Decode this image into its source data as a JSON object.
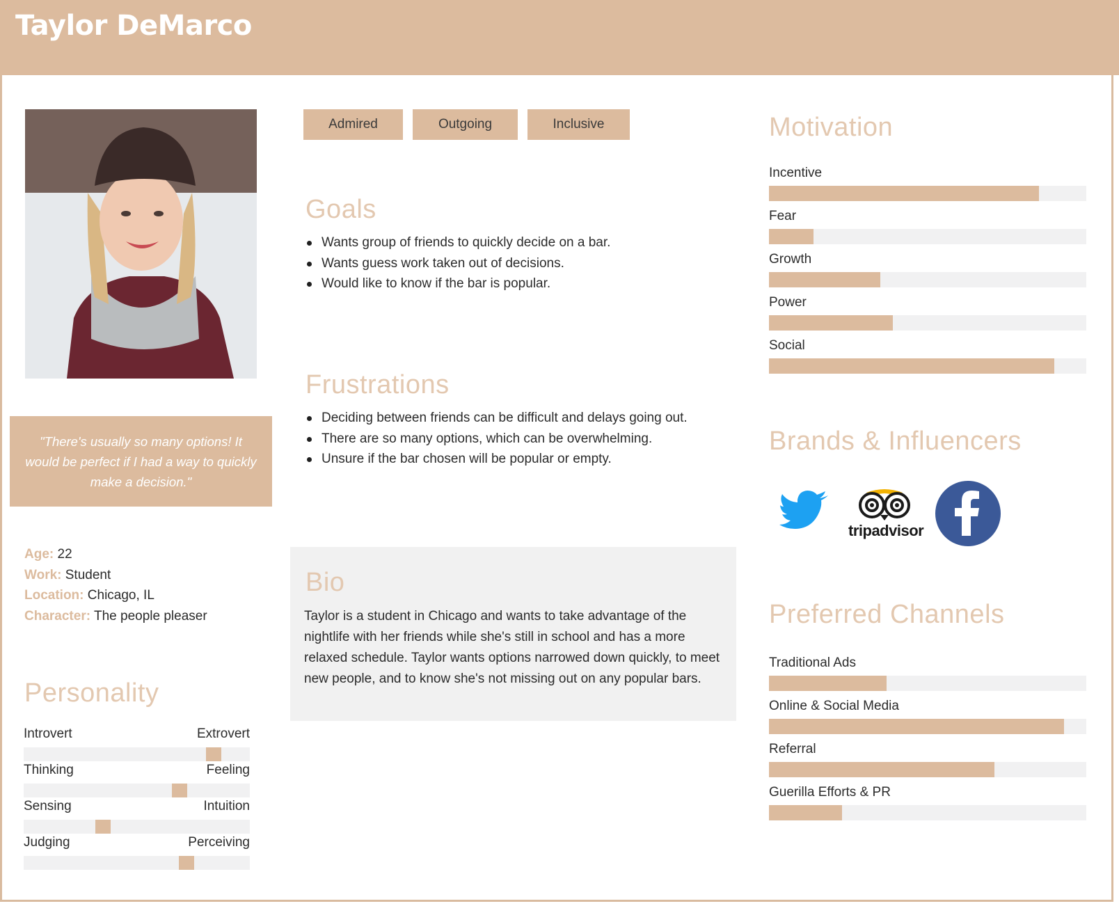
{
  "persona": {
    "name": "Taylor DeMarco",
    "quote": "\"There's usually so many options! It would be perfect if I had a way to quickly make a decision.\"",
    "facts": [
      {
        "key": "Age:",
        "value": " 22"
      },
      {
        "key": "Work:",
        "value": " Student"
      },
      {
        "key": "Location:",
        "value": " Chicago, IL"
      },
      {
        "key": "Character:",
        "value": " The people pleaser"
      }
    ]
  },
  "tags": [
    "Admired",
    "Outgoing",
    "Inclusive"
  ],
  "personality": {
    "title": "Personality",
    "scales": [
      {
        "left": "Introvert",
        "right": "Extrovert",
        "value": 0.84
      },
      {
        "left": "Thinking",
        "right": "Feeling",
        "value": 0.69
      },
      {
        "left": "Sensing",
        "right": "Intuition",
        "value": 0.35
      },
      {
        "left": "Judging",
        "right": "Perceiving",
        "value": 0.72
      }
    ]
  },
  "goals": {
    "title": "Goals",
    "items": [
      "Wants group of friends to quickly decide on a bar.",
      "Wants guess work taken out of decisions.",
      "Would like to know if the bar is popular."
    ]
  },
  "frustrations": {
    "title": "Frustrations",
    "items": [
      "Deciding between friends can be difficult and delays going out.",
      "There are so many options, which can be overwhelming.",
      "Unsure if the bar chosen will be popular or empty."
    ]
  },
  "bio": {
    "title": "Bio",
    "text": "Taylor is a student in Chicago and wants to take advantage of the nightlife with her friends while she's still in school and has a more relaxed schedule. Taylor wants options narrowed down quickly, to meet new people, and to know she's not missing out on any popular bars."
  },
  "motivation": {
    "title": "Motivation",
    "items": [
      {
        "label": "Incentive",
        "value": 0.85
      },
      {
        "label": "Fear",
        "value": 0.14
      },
      {
        "label": "Growth",
        "value": 0.35
      },
      {
        "label": "Power",
        "value": 0.39
      },
      {
        "label": "Social",
        "value": 0.9
      }
    ]
  },
  "brands": {
    "title": "Brands & Influencers",
    "logos": [
      "twitter-logo",
      "tripadvisor-logo",
      "facebook-logo"
    ],
    "tripadvisor_text": "tripadvisor"
  },
  "channels": {
    "title": "Preferred Channels",
    "items": [
      {
        "label": "Traditional Ads",
        "value": 0.37
      },
      {
        "label": "Online & Social Media",
        "value": 0.93
      },
      {
        "label": "Referral",
        "value": 0.71
      },
      {
        "label": "Guerilla Efforts & PR",
        "value": 0.23
      }
    ]
  },
  "colors": {
    "accent": "#dcbb9e",
    "title": "#e3c8b0",
    "track": "#f1f1f2"
  }
}
